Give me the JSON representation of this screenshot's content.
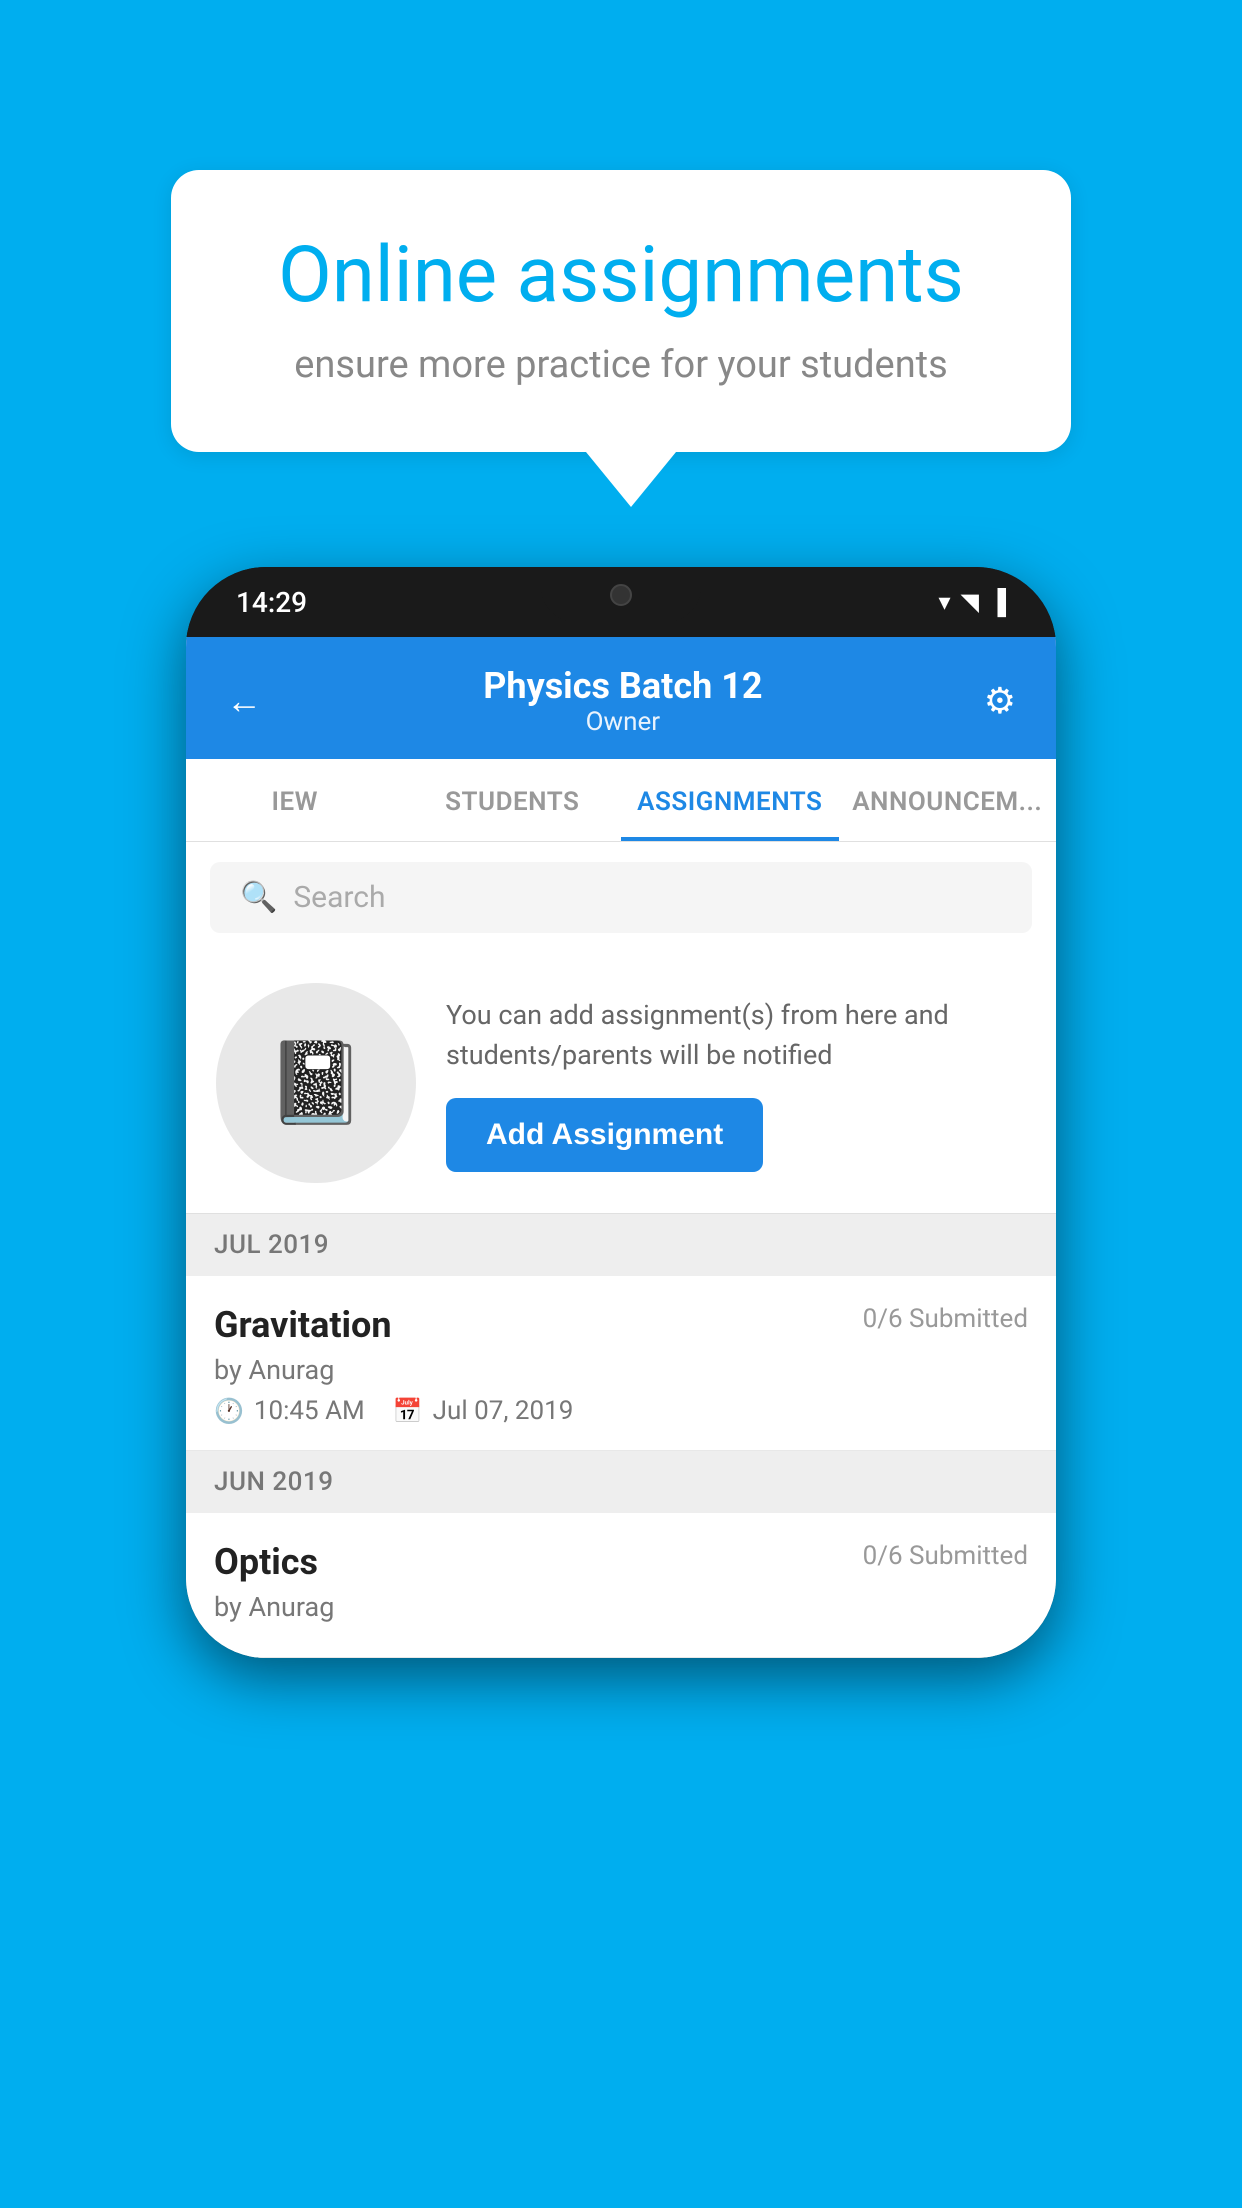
{
  "background_color": "#00AEEF",
  "speech_bubble": {
    "title": "Online assignments",
    "subtitle": "ensure more practice for your students"
  },
  "phone": {
    "status_bar": {
      "time": "14:29",
      "icons": [
        "wifi",
        "signal",
        "battery"
      ]
    },
    "header": {
      "title": "Physics Batch 12",
      "subtitle": "Owner",
      "back_label": "←",
      "settings_label": "⚙"
    },
    "tabs": [
      {
        "label": "IEW",
        "active": false
      },
      {
        "label": "STUDENTS",
        "active": false
      },
      {
        "label": "ASSIGNMENTS",
        "active": true
      },
      {
        "label": "ANNOUNCEM...",
        "active": false
      }
    ],
    "search": {
      "placeholder": "Search"
    },
    "promo": {
      "description": "You can add assignment(s) from here and students/parents will be notified",
      "button_label": "Add Assignment"
    },
    "sections": [
      {
        "month_label": "JUL 2019",
        "assignments": [
          {
            "title": "Gravitation",
            "status": "0/6 Submitted",
            "author": "by Anurag",
            "time": "10:45 AM",
            "date": "Jul 07, 2019"
          }
        ]
      },
      {
        "month_label": "JUN 2019",
        "assignments": [
          {
            "title": "Optics",
            "status": "0/6 Submitted",
            "author": "by Anurag",
            "time": "",
            "date": ""
          }
        ]
      }
    ]
  }
}
